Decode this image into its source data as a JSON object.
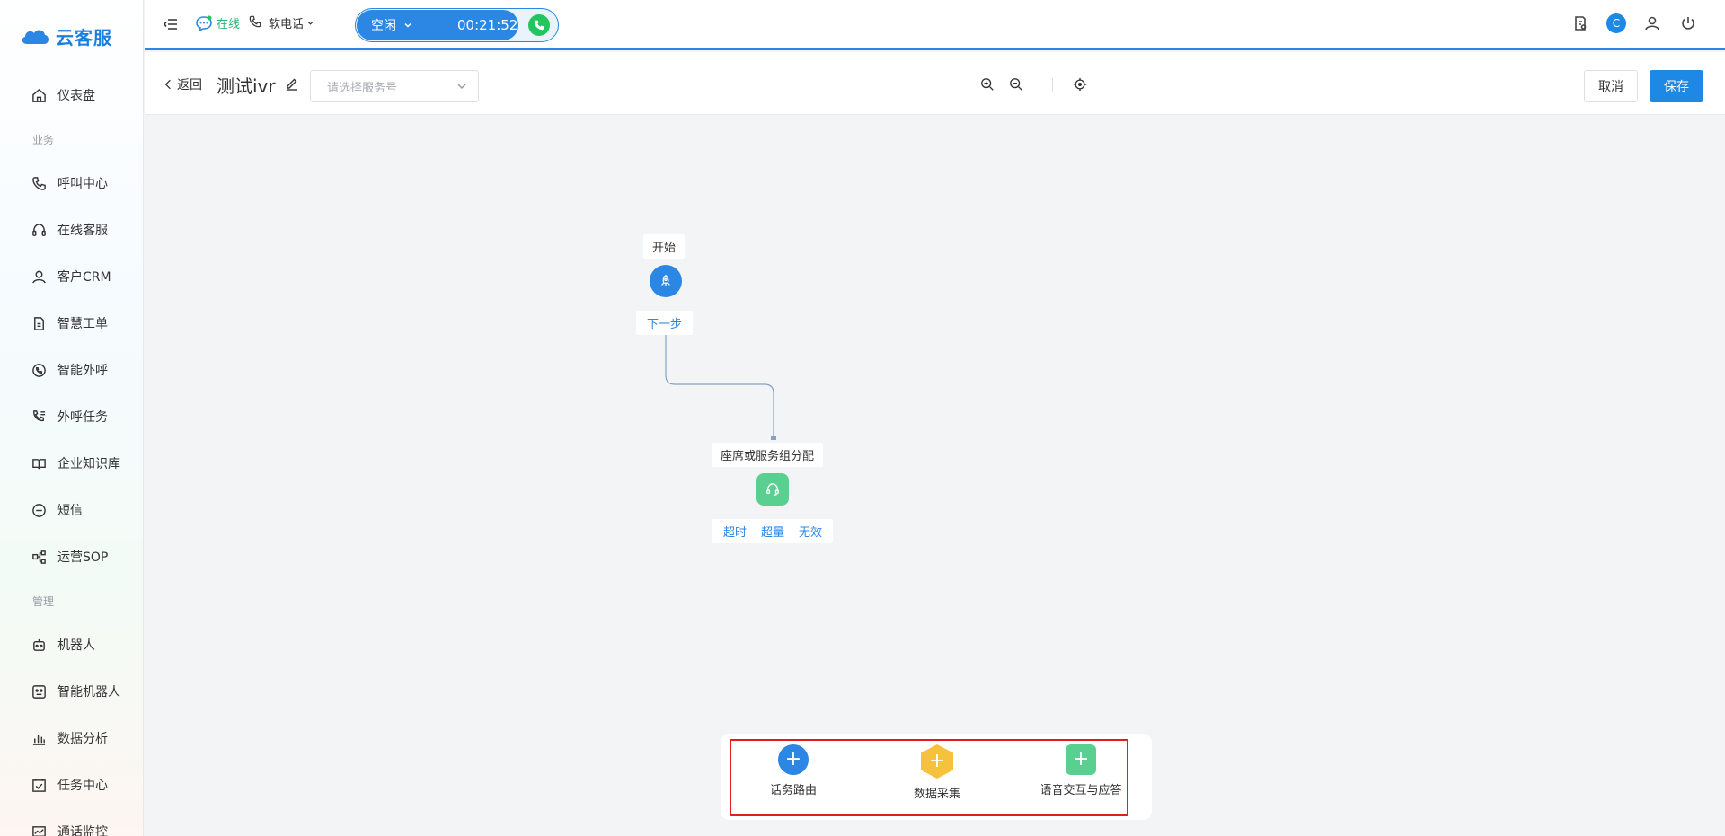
{
  "app": {
    "name": "云客服",
    "brand_color": "#1b7fe0",
    "accent_color": "#2b87e3"
  },
  "sidebar": {
    "items": [
      {
        "label": "仪表盘",
        "icon": "home-icon"
      },
      {
        "section": "业务"
      },
      {
        "label": "呼叫中心",
        "icon": "phone-icon"
      },
      {
        "label": "在线客服",
        "icon": "headset-icon"
      },
      {
        "label": "客户CRM",
        "icon": "user-icon"
      },
      {
        "label": "智慧工单",
        "icon": "document-icon"
      },
      {
        "label": "智能外呼",
        "icon": "chat-phone-icon"
      },
      {
        "label": "外呼任务",
        "icon": "phone-list-icon"
      },
      {
        "label": "企业知识库",
        "icon": "book-icon"
      },
      {
        "label": "短信",
        "icon": "sms-icon"
      },
      {
        "label": "运营SOP",
        "icon": "flow-icon"
      },
      {
        "section": "管理"
      },
      {
        "label": "机器人",
        "icon": "robot-icon"
      },
      {
        "label": "智能机器人",
        "icon": "robot-face-icon"
      },
      {
        "label": "数据分析",
        "icon": "bar-chart-icon"
      },
      {
        "label": "任务中心",
        "icon": "task-icon"
      },
      {
        "label": "通话监控",
        "icon": "monitor-icon"
      }
    ]
  },
  "header": {
    "status": "在线",
    "phone_mode": "软电话",
    "call_state": "空闲",
    "call_timer": "00:21:52",
    "avatar_letter": "C"
  },
  "toolbar": {
    "back_label": "返回",
    "flow_name": "测试ivr",
    "service_placeholder": "请选择服务号",
    "cancel_label": "取消",
    "save_label": "保存"
  },
  "canvas": {
    "start_node": {
      "label": "开始",
      "next_label": "下一步"
    },
    "assign_node": {
      "label": "座席或服务组分配",
      "exits": [
        "超时",
        "超量",
        "无效"
      ]
    }
  },
  "palette": {
    "items": [
      {
        "label": "话务路由",
        "shape": "circle",
        "color": "#2b87e3"
      },
      {
        "label": "数据采集",
        "shape": "hexagon",
        "color": "#f6c23e"
      },
      {
        "label": "语音交互与应答",
        "shape": "square",
        "color": "#59d08f"
      }
    ],
    "highlight_color": "#e11d1d"
  }
}
